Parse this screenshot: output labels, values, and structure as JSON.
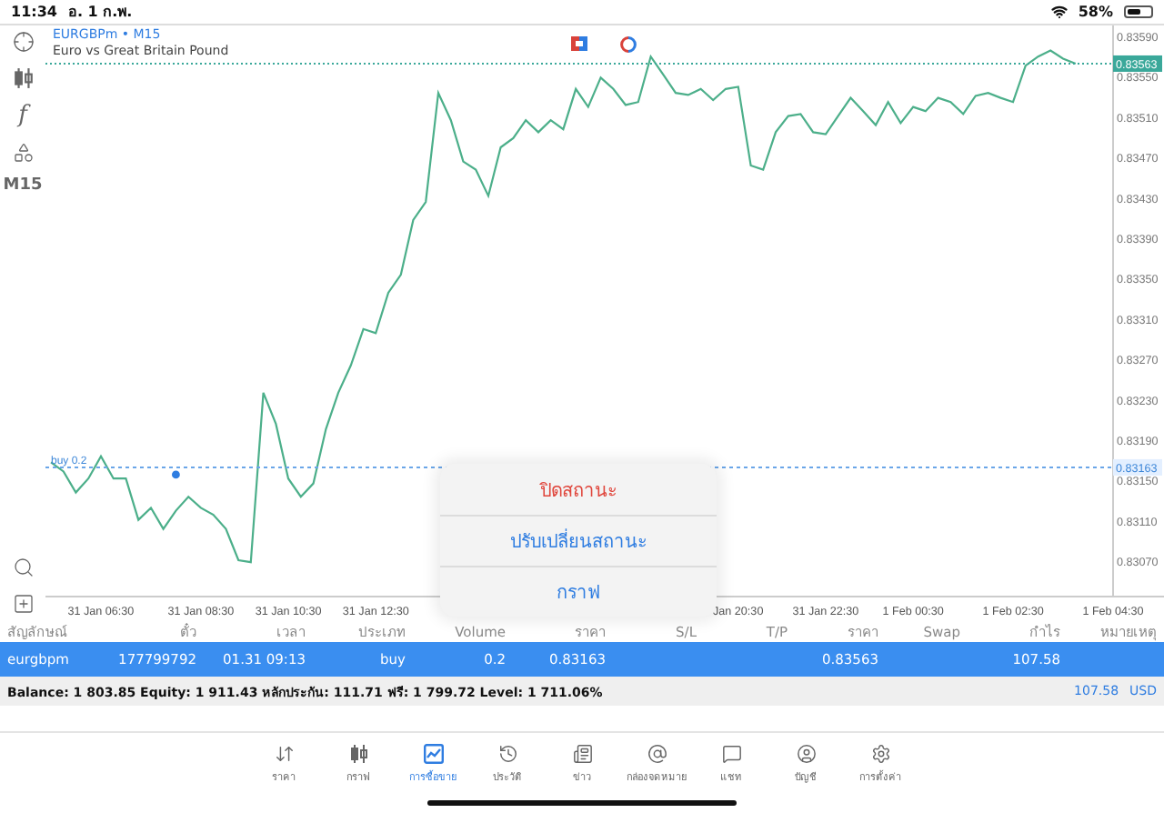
{
  "status_bar": {
    "time": "11:34",
    "date": "อ. 1 ก.พ.",
    "battery": "58%"
  },
  "toolbar": {
    "indicator": "f",
    "timeframe": "M15"
  },
  "chart": {
    "title": "EURGBPm • M15",
    "description": "Euro vs Great Britain Pound",
    "position_label": "buy 0.2",
    "chart_data": {
      "type": "line",
      "categories": [
        null,
        null,
        null,
        null,
        "31 Jan 06:30",
        null,
        null,
        null,
        null,
        null,
        null,
        null,
        "31 Jan 08:30",
        null,
        null,
        null,
        null,
        null,
        null,
        "31 Jan 10:30",
        null,
        null,
        null,
        null,
        null,
        null,
        "31 Jan 12:30",
        null,
        null,
        null,
        null,
        null,
        null,
        null,
        null,
        null,
        null,
        null,
        null,
        null,
        null,
        null,
        null,
        null,
        null,
        null,
        null,
        null,
        null,
        null,
        null,
        null,
        null,
        null,
        null,
        "Jan 20:30",
        null,
        null,
        null,
        null,
        null,
        null,
        "31 Jan 22:30",
        null,
        null,
        null,
        null,
        null,
        null,
        "1 Feb 00:30",
        null,
        null,
        null,
        null,
        null,
        null,
        null,
        "1 Feb 02:30",
        null,
        null,
        null,
        null,
        null,
        null,
        null,
        "1 Feb 04:30"
      ],
      "series": [
        {
          "color": "#4caf8a",
          "values": [
            0.83168,
            0.83159,
            0.83138,
            0.83152,
            0.83174,
            0.83152,
            0.83152,
            0.83111,
            0.83123,
            0.83102,
            0.8312,
            0.83134,
            0.83123,
            0.83116,
            0.83102,
            0.83071,
            0.83069,
            0.83237,
            0.83206,
            0.83152,
            0.83134,
            0.83147,
            0.83201,
            0.83237,
            0.83264,
            0.833,
            0.83296,
            0.83336,
            0.83354,
            0.83408,
            0.83426,
            0.83534,
            0.83507,
            0.83466,
            0.83458,
            0.83432,
            0.8348,
            0.83489,
            0.83507,
            0.83495,
            0.83507,
            0.83498,
            0.83538,
            0.8352,
            0.83549,
            0.83538,
            0.83522,
            0.83525,
            0.8357,
            0.83552,
            0.83534,
            0.83532,
            0.83538,
            0.83527,
            0.83538,
            0.8354,
            0.83462,
            0.83458,
            0.83495,
            0.83511,
            0.83513,
            0.83495,
            0.83493,
            0.83511,
            0.83529,
            0.83516,
            0.83502,
            0.83525,
            0.83504,
            0.8352,
            0.83516,
            0.83529,
            0.83525,
            0.83513,
            0.83531,
            0.83534,
            0.83529,
            0.83525,
            0.83561,
            0.8357,
            0.83576,
            0.83568,
            0.83563,
            null,
            null,
            null
          ]
        }
      ],
      "ylim": [
        0.83035,
        0.83599
      ],
      "ref_lines": [
        {
          "axis": "y",
          "value": 0.83563,
          "label": "0.83563",
          "color": "#3aa89a"
        },
        {
          "axis": "y",
          "value": 0.83163,
          "label": "0.83163",
          "color": "#6aa6e8"
        }
      ],
      "yticks": [
        {
          "value": 0.8307,
          "label": "0.83070"
        },
        {
          "value": 0.8311,
          "label": "0.83110"
        },
        {
          "value": 0.8315,
          "label": "0.83150"
        },
        {
          "value": 0.8319,
          "label": "0.83190"
        },
        {
          "value": 0.8323,
          "label": "0.83230"
        },
        {
          "value": 0.8327,
          "label": "0.83270"
        },
        {
          "value": 0.8331,
          "label": "0.83310"
        },
        {
          "value": 0.8335,
          "label": "0.83350"
        },
        {
          "value": 0.8339,
          "label": "0.83390"
        },
        {
          "value": 0.8343,
          "label": "0.83430"
        },
        {
          "value": 0.8347,
          "label": "0.83470"
        },
        {
          "value": 0.8351,
          "label": "0.83510"
        },
        {
          "value": 0.8355,
          "label": "0.83550"
        },
        {
          "value": 0.8359,
          "label": "0.83590"
        }
      ]
    }
  },
  "popup": {
    "items": [
      {
        "label": "ปิดสถานะ",
        "kind": "destructive"
      },
      {
        "label": "ปรับเปลี่ยนสถานะ",
        "kind": "default"
      },
      {
        "label": "กราฟ",
        "kind": "default"
      }
    ]
  },
  "positions": {
    "columns": [
      "สัญลักษณ์",
      "ตั๋ว",
      "เวลา",
      "ประเภท",
      "Volume",
      "ราคา",
      "S/L",
      "T/P",
      "ราคา",
      "Swap",
      "กำไร",
      "หมายเหตุ"
    ],
    "rows": [
      {
        "selected": true,
        "cells": [
          "eurgbpm",
          "177799792",
          "01.31 09:13",
          "buy",
          "0.2",
          "0.83163",
          null,
          null,
          "0.83563",
          null,
          "107.58",
          null
        ]
      }
    ],
    "summary": {
      "text": "Balance: 1 803.85 Equity: 1 911.43 หลักประกัน: 111.71 ฟรี: 1 799.72 Level: 1 711.06%",
      "profit": "107.58",
      "currency": "USD"
    }
  },
  "tab_bar": {
    "tabs": [
      {
        "label": "ราคา",
        "selected": false
      },
      {
        "label": "กราฟ",
        "selected": false
      },
      {
        "label": "การซื้อขาย",
        "selected": true
      },
      {
        "label": "ประวัติ",
        "selected": false
      },
      {
        "label": "ข่าว",
        "selected": false
      },
      {
        "label": "กล่องจดหมาย",
        "selected": false
      },
      {
        "label": "แชท",
        "selected": false
      },
      {
        "label": "บัญชี",
        "selected": false
      },
      {
        "label": "การตั้งค่า",
        "selected": false
      }
    ]
  }
}
